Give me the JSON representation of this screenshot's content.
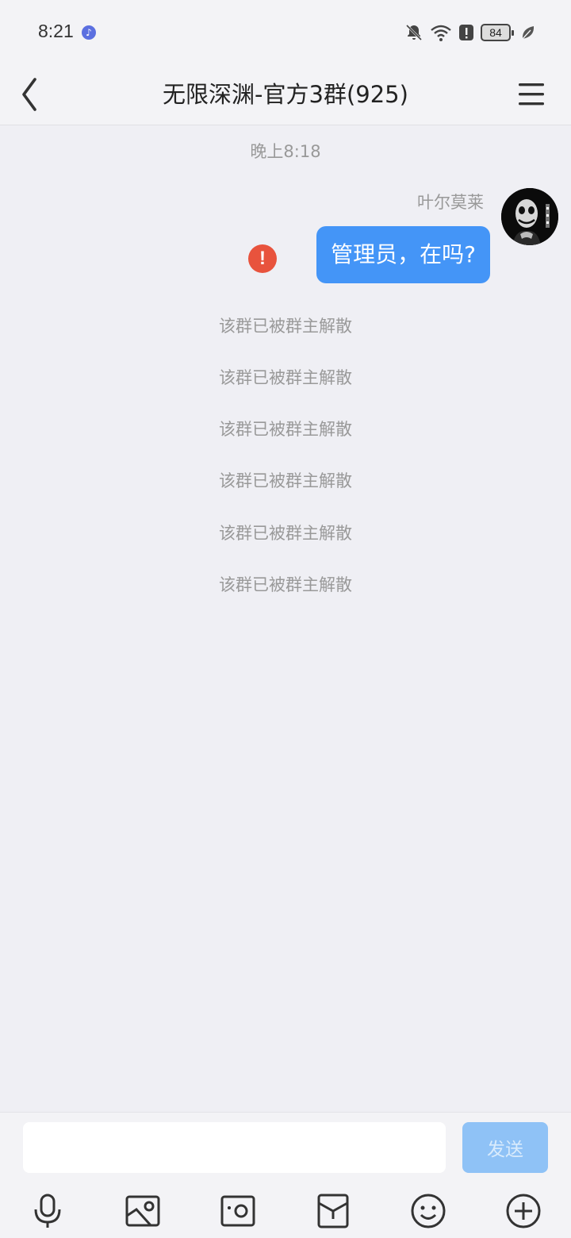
{
  "status_bar": {
    "time": "8:21",
    "battery": "84",
    "icons": [
      "music-icon",
      "bell-off-icon",
      "wifi-icon",
      "alert-icon",
      "battery-icon",
      "leaf-icon"
    ]
  },
  "header": {
    "title": "无限深渊-官方3群(925)",
    "back_icon": "chevron-left-icon",
    "menu_icon": "menu-icon"
  },
  "chat": {
    "timestamp": "晚上8:18",
    "message": {
      "sender": "叶尔莫莱",
      "text": "管理员，在吗?",
      "status_icon": "send-failed-icon"
    },
    "notices": [
      "该群已被群主解散",
      "该群已被群主解散",
      "该群已被群主解散",
      "该群已被群主解散",
      "该群已被群主解散",
      "该群已被群主解散"
    ]
  },
  "input_bar": {
    "placeholder": "",
    "send_label": "发送",
    "tools": [
      "microphone-icon",
      "image-icon",
      "camera-icon",
      "red-packet-icon",
      "emoji-icon",
      "plus-icon"
    ]
  },
  "colors": {
    "bubble": "#4495f7",
    "send_disabled": "#8fc2f6",
    "error": "#e8533d",
    "background": "#efeff4"
  }
}
